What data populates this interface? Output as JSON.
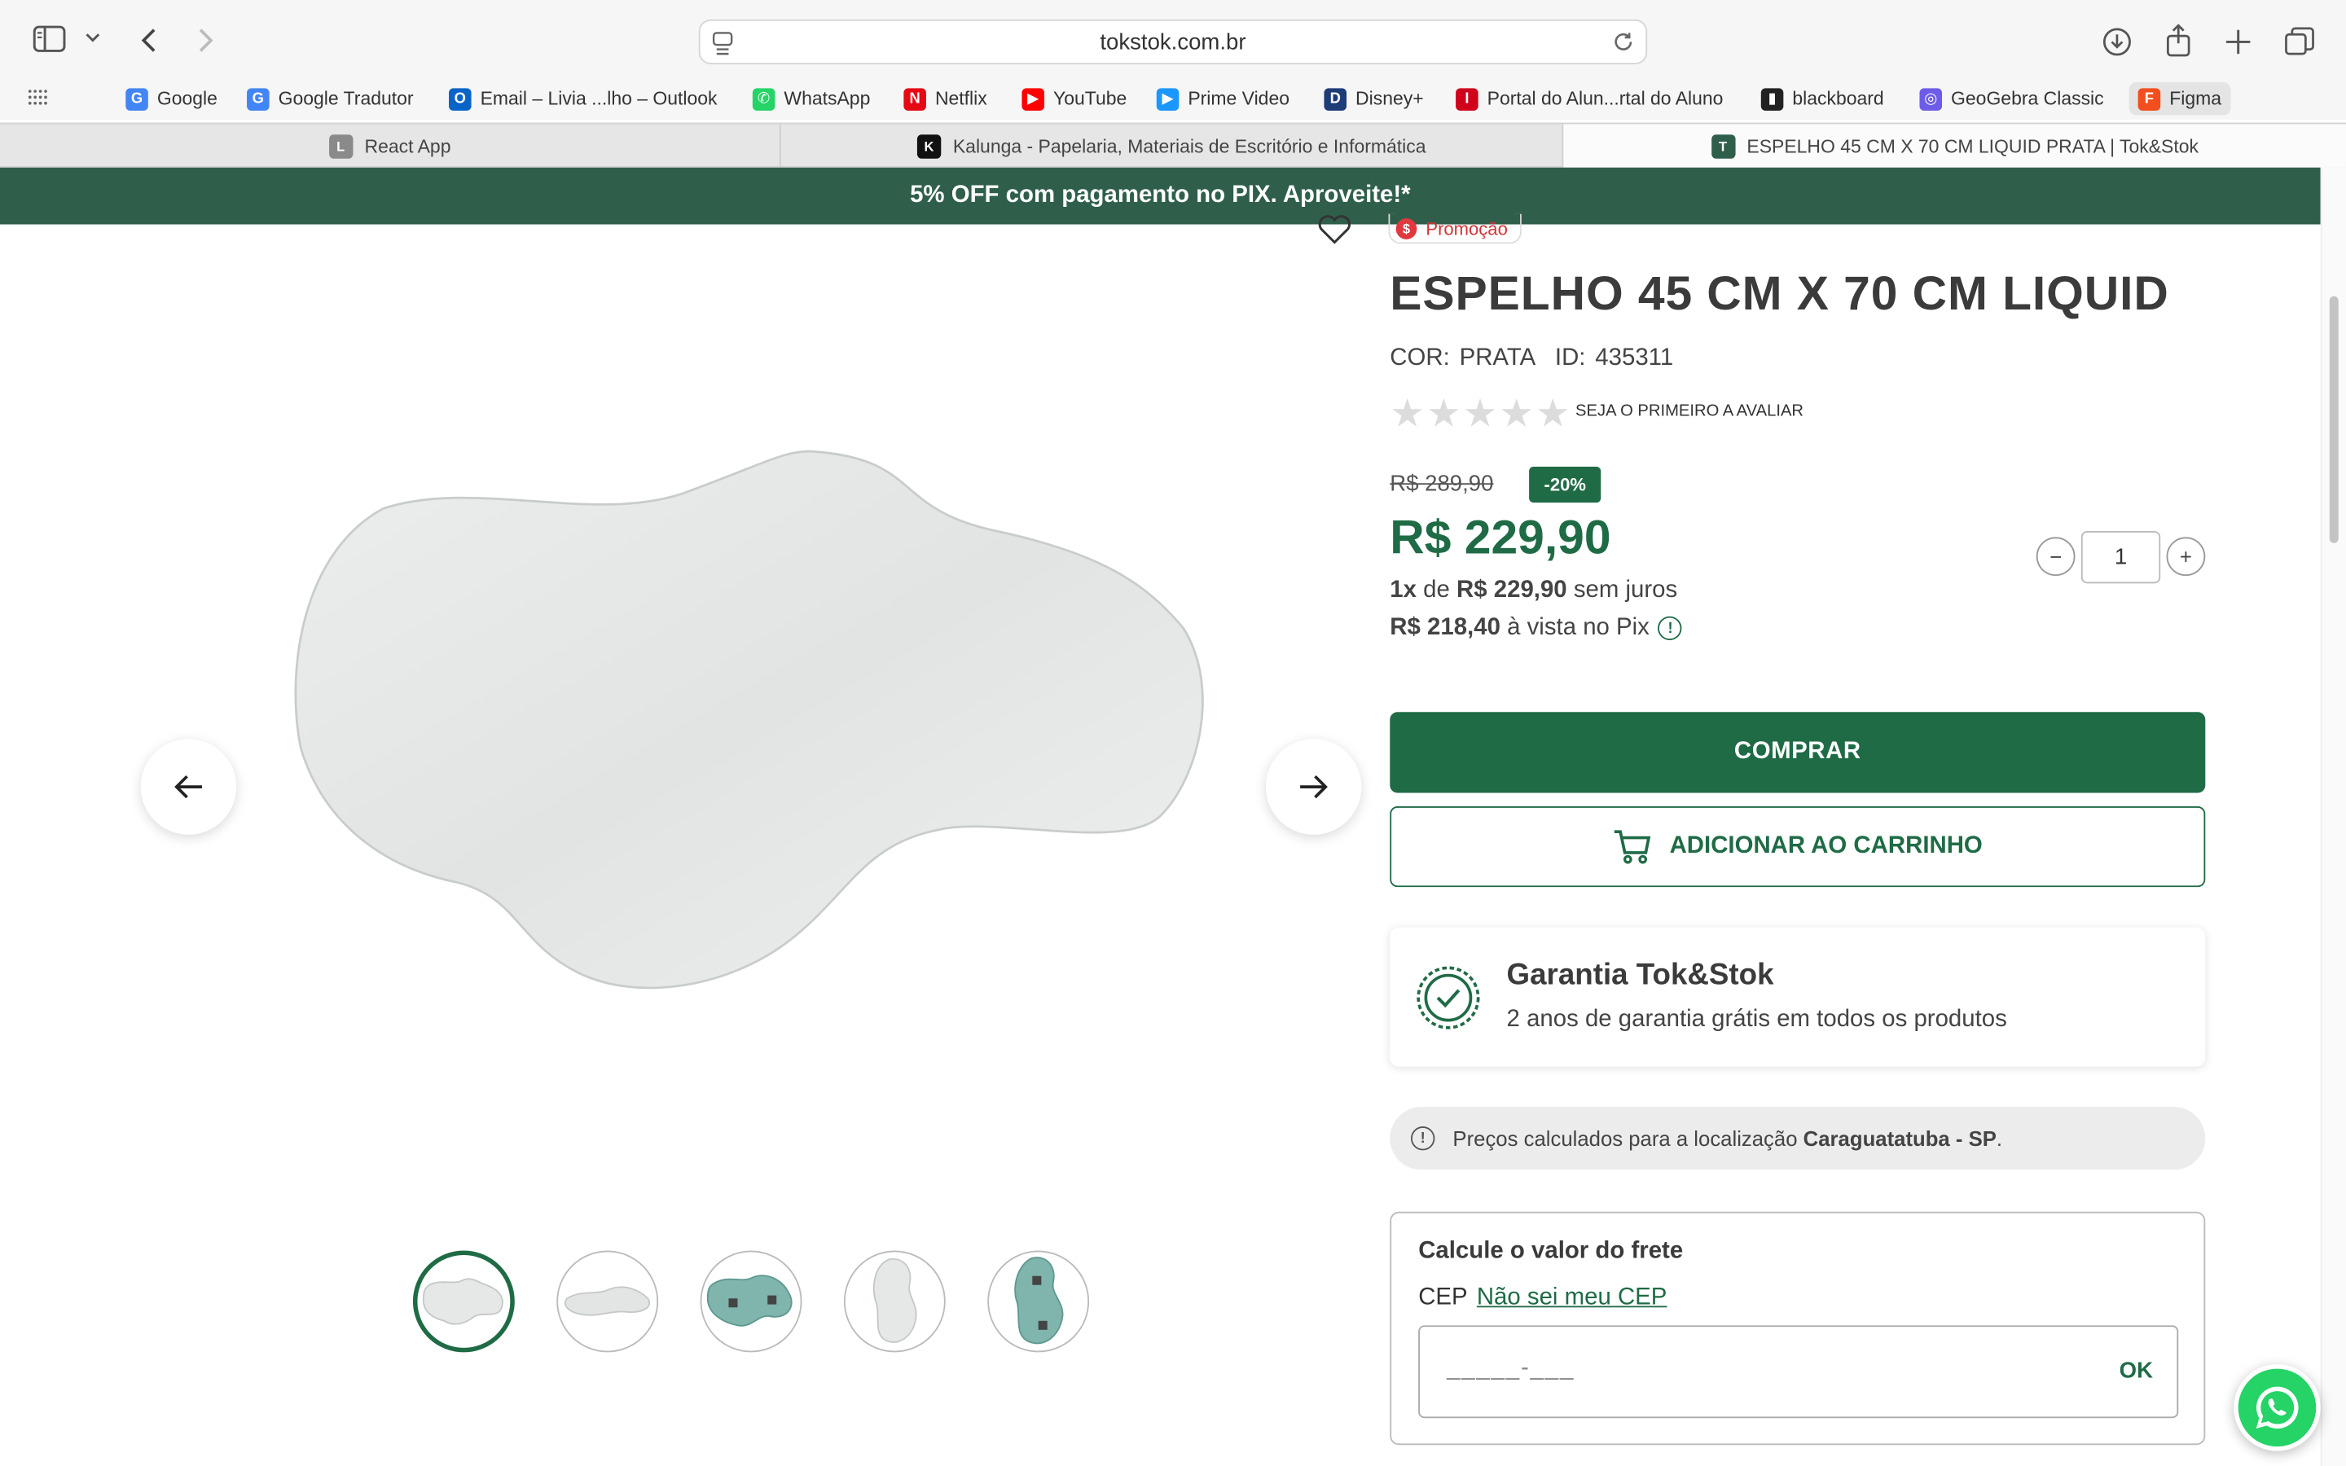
{
  "browser": {
    "url": "tokstok.com.br",
    "bookmarks": [
      {
        "label": "Google",
        "icon": "google-icon",
        "color": "#4285f4",
        "glyph": "G"
      },
      {
        "label": "Google Tradutor",
        "icon": "google-translate-icon",
        "color": "#4285f4",
        "glyph": "G"
      },
      {
        "label": "Email – Livia ...lho – Outlook",
        "icon": "outlook-icon",
        "color": "#0a64c8",
        "glyph": "O"
      },
      {
        "label": "WhatsApp",
        "icon": "whatsapp-icon",
        "color": "#25d366",
        "glyph": "✆"
      },
      {
        "label": "Netflix",
        "icon": "netflix-icon",
        "color": "#e50914",
        "glyph": "N"
      },
      {
        "label": "YouTube",
        "icon": "youtube-icon",
        "color": "#ff0000",
        "glyph": "▶"
      },
      {
        "label": "Prime Video",
        "icon": "prime-video-icon",
        "color": "#1a98ff",
        "glyph": "▶"
      },
      {
        "label": "Disney+",
        "icon": "disney-plus-icon",
        "color": "#1d3c78",
        "glyph": "D"
      },
      {
        "label": "Portal do Alun...rtal do Aluno",
        "icon": "portal-icon",
        "color": "#d0021b",
        "glyph": "I"
      },
      {
        "label": "blackboard",
        "icon": "blackboard-icon",
        "color": "#222222",
        "glyph": "▮"
      },
      {
        "label": "GeoGebra Classic",
        "icon": "geogebra-icon",
        "color": "#6c5ce7",
        "glyph": "◎"
      },
      {
        "label": "Figma",
        "icon": "figma-icon",
        "color": "#f24e1e",
        "glyph": "F"
      }
    ],
    "tabs": [
      {
        "label": "React App",
        "icon": "react-app-icon",
        "glyph": "L",
        "color": "#8a8a8a"
      },
      {
        "label": "Kalunga - Papelaria, Materiais de Escritório e Informática",
        "icon": "kalunga-icon",
        "glyph": "K",
        "color": "#111111"
      },
      {
        "label": "ESPELHO 45 CM X 70 CM LIQUID PRATA | Tok&Stok",
        "icon": "tokstok-icon",
        "glyph": "T",
        "color": "#2f5f4b"
      }
    ]
  },
  "promo_banner": "5% OFF com pagamento no PIX. Aproveite!*",
  "product": {
    "badge": "Promoção",
    "title": "ESPELHO 45 CM X 70 CM LIQUID",
    "color_label": "COR: PRATA",
    "id_label": "ID: 435311",
    "rating_cta": "SEJA O PRIMEIRO A AVALIAR",
    "rating_stars": 0,
    "old_price": "R$ 289,90",
    "discount": "-20%",
    "price": "R$ 229,90",
    "installments_prefix": "1x",
    "installments_mid": "de",
    "installments_value": "R$ 229,90",
    "installments_suffix": "sem juros",
    "pix_value": "R$ 218,40",
    "pix_suffix": "à vista no Pix",
    "quantity": "1",
    "buy_label": "COMPRAR",
    "cart_label": "ADICIONAR AO CARRINHO"
  },
  "warranty": {
    "title": "Garantia Tok&Stok",
    "description": "2 anos de garantia grátis em todos os produtos"
  },
  "location": {
    "prefix": "Preços calculados para a localização",
    "city": "Caraguatatuba - SP",
    "suffix": "."
  },
  "freight": {
    "title": "Calcule o valor do frete",
    "cep_label": "CEP",
    "unknown_cep_link": "Não sei meu CEP",
    "mask": "_____-___",
    "ok_label": "OK"
  },
  "colors": {
    "brand_green": "#1f6b45",
    "banner_green": "#2f5f4b",
    "promo_red": "#e03a3e"
  }
}
